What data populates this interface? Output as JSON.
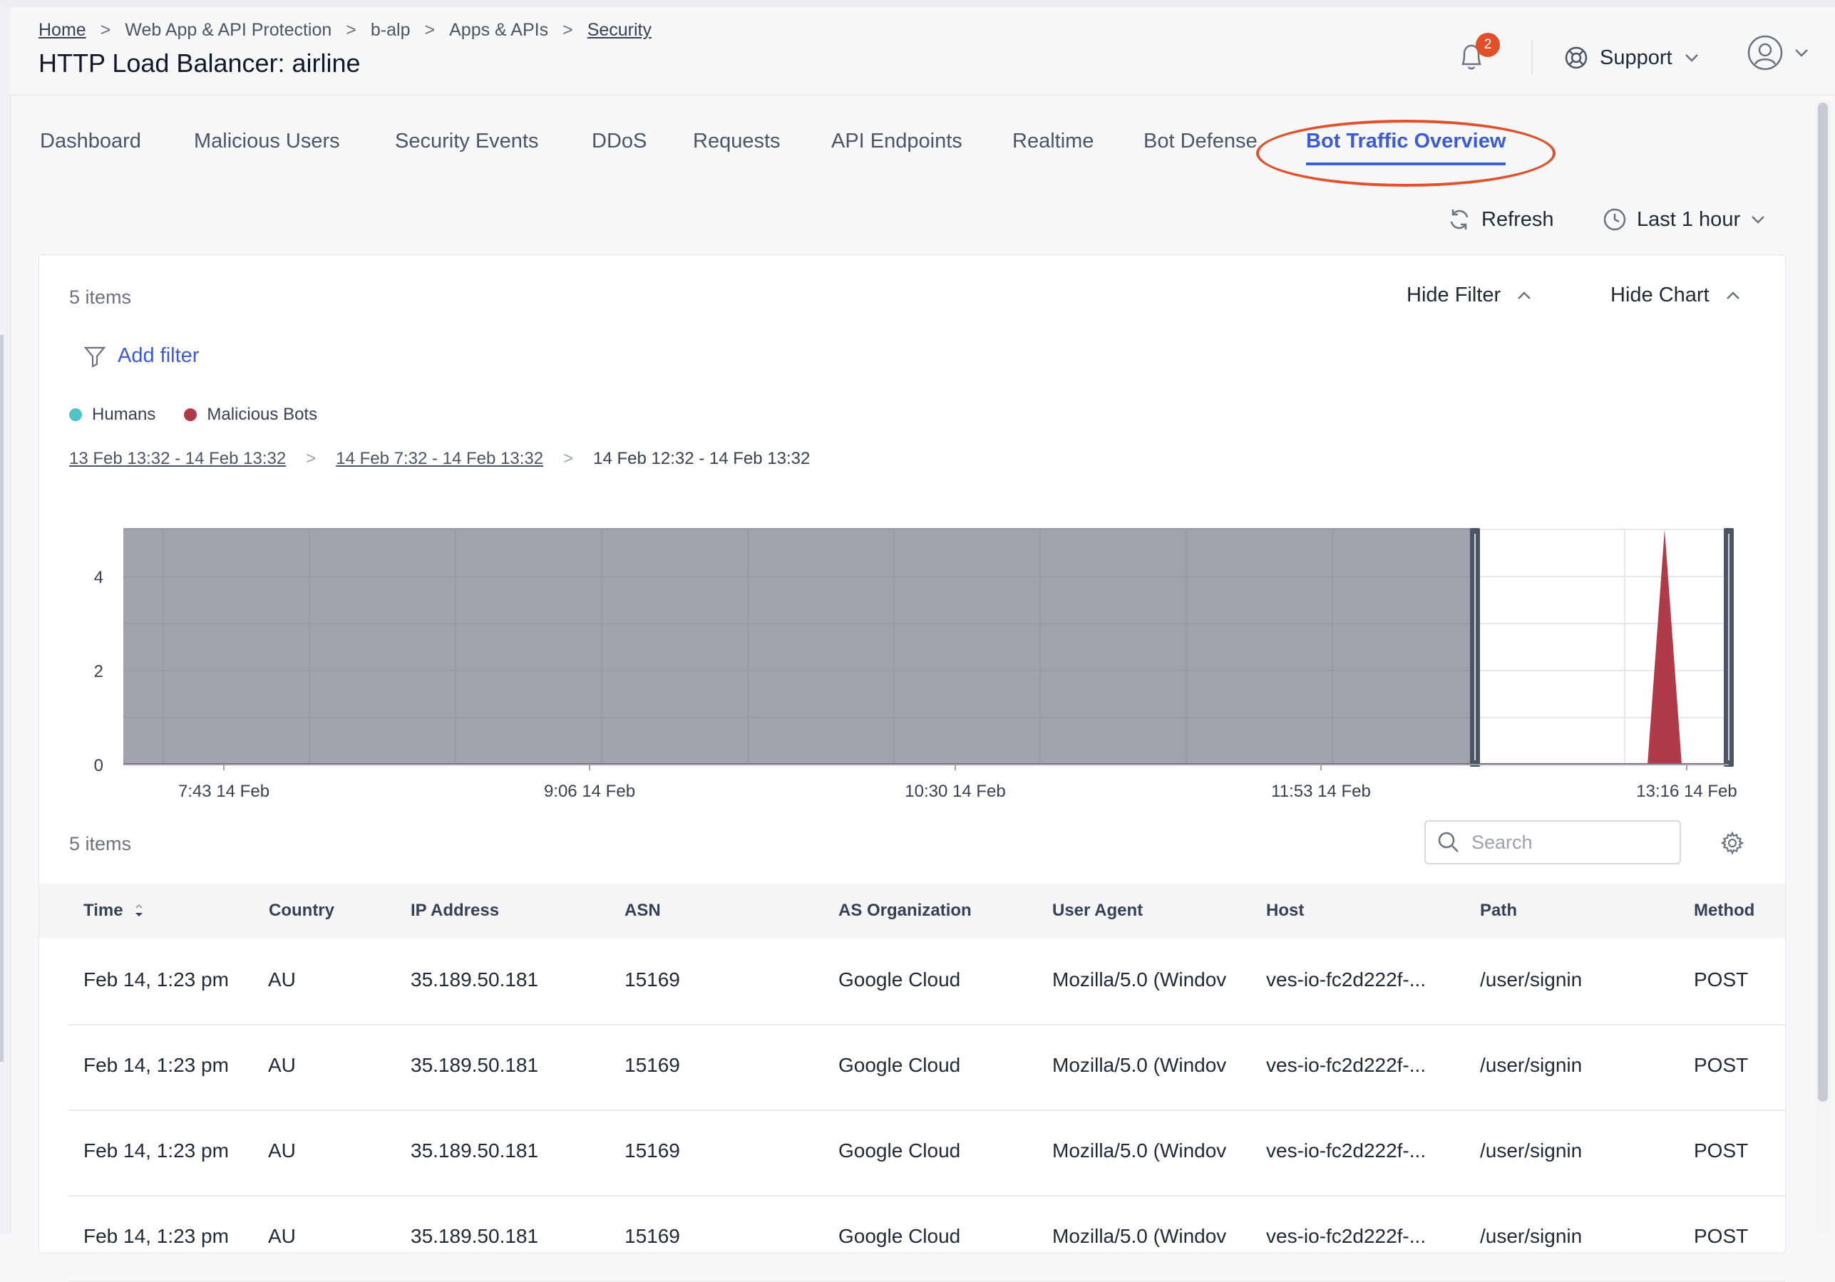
{
  "breadcrumb": {
    "items": [
      "Home",
      "Web App & API Protection",
      "b-alp",
      "Apps & APIs",
      "Security"
    ]
  },
  "page_title": "HTTP Load Balancer: airline",
  "header": {
    "notification_count": "2",
    "support_label": "Support"
  },
  "tabs": [
    "Dashboard",
    "Malicious Users",
    "Security Events",
    "DDoS",
    "Requests",
    "API Endpoints",
    "Realtime",
    "Bot Defense",
    "Bot Traffic Overview"
  ],
  "active_tab": "Bot Traffic Overview",
  "actions": {
    "refresh_label": "Refresh",
    "time_range_label": "Last 1 hour"
  },
  "panel": {
    "item_count": "5 items",
    "hide_filter_label": "Hide Filter",
    "hide_chart_label": "Hide Chart",
    "add_filter_label": "Add filter",
    "legend": [
      "Humans",
      "Malicious Bots"
    ],
    "ranges": [
      "13 Feb 13:32 - 14 Feb 13:32",
      "14 Feb 7:32 - 14 Feb 13:32",
      "14 Feb 12:32 - 14 Feb 13:32"
    ]
  },
  "chart_data": {
    "type": "area",
    "y_ticks": [
      "0",
      "2",
      "4"
    ],
    "x_ticks": [
      "7:43 14 Feb",
      "9:06 14 Feb",
      "10:30 14 Feb",
      "11:53 14 Feb",
      "13:16 14 Feb"
    ],
    "ylim": [
      0,
      5
    ],
    "series": [
      {
        "name": "Humans",
        "color": "#4fc3c7",
        "values": [
          0,
          0,
          0,
          0,
          0,
          0,
          0
        ]
      },
      {
        "name": "Malicious Bots",
        "color": "#b03a48",
        "values": [
          0,
          0,
          0,
          0,
          0,
          5,
          0
        ]
      }
    ],
    "grid": true,
    "selection_brush": "shaded area from start of range to about 12:32 14 Feb"
  },
  "table": {
    "item_count": "5 items",
    "search_placeholder": "Search",
    "columns": [
      "Time",
      "Country",
      "IP Address",
      "ASN",
      "AS Organization",
      "User Agent",
      "Host",
      "Path",
      "Method"
    ],
    "rows": [
      [
        "Feb 14, 1:23 pm",
        "AU",
        "35.189.50.181",
        "15169",
        "Google Cloud",
        "Mozilla/5.0 (Windov",
        "ves-io-fc2d222f-...",
        "/user/signin",
        "POST"
      ],
      [
        "Feb 14, 1:23 pm",
        "AU",
        "35.189.50.181",
        "15169",
        "Google Cloud",
        "Mozilla/5.0 (Windov",
        "ves-io-fc2d222f-...",
        "/user/signin",
        "POST"
      ],
      [
        "Feb 14, 1:23 pm",
        "AU",
        "35.189.50.181",
        "15169",
        "Google Cloud",
        "Mozilla/5.0 (Windov",
        "ves-io-fc2d222f-...",
        "/user/signin",
        "POST"
      ],
      [
        "Feb 14, 1:23 pm",
        "AU",
        "35.189.50.181",
        "15169",
        "Google Cloud",
        "Mozilla/5.0 (Windov",
        "ves-io-fc2d222f-...",
        "/user/signin",
        "POST"
      ]
    ]
  }
}
